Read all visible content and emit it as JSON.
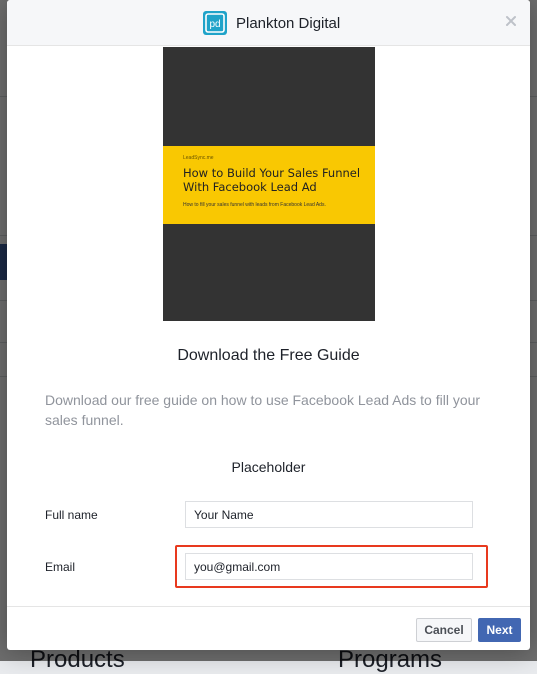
{
  "background": {
    "bottom_left_text": "Products",
    "bottom_right_text": "Programs"
  },
  "header": {
    "brand_name": "Plankton Digital",
    "logo_text": "pd"
  },
  "cover": {
    "brand": "LeadSync.me",
    "title": "How to Build Your Sales Funnel With Facebook Lead Ad",
    "subtitle": "How to fill your sales funnel with leads from Facebook Lead Ads."
  },
  "guide": {
    "title": "Download the Free Guide",
    "description": "Download our free guide on how to use Facebook Lead Ads to fill your sales funnel."
  },
  "form": {
    "section_heading": "Placeholder",
    "full_name_label": "Full name",
    "full_name_value": "Your Name",
    "email_label": "Email",
    "email_value": "you@gmail.com"
  },
  "footer": {
    "cancel_label": "Cancel",
    "next_label": "Next"
  },
  "colors": {
    "accent": "#4267b2",
    "highlight": "#e8391e",
    "cover_band": "#f9c802",
    "cover_dark": "#333333",
    "logo": "#1fa3c9"
  },
  "icons": {
    "close": "close-icon",
    "logo": "plankton-digital-logo-icon"
  }
}
